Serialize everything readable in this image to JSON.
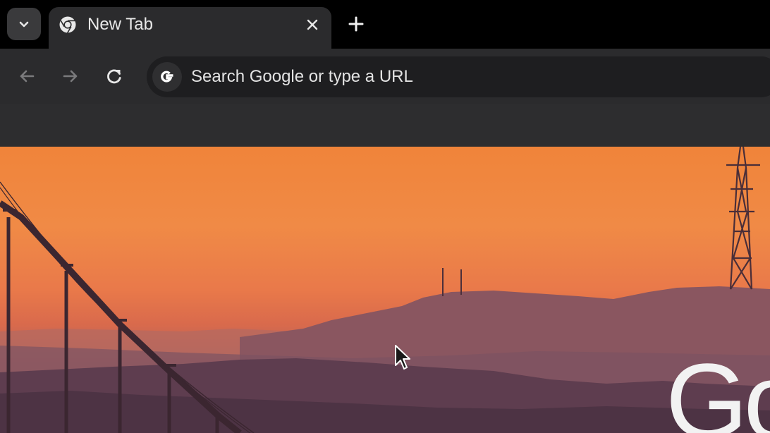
{
  "tabstrip": {
    "tab_search_icon": "chevron-down-icon",
    "active_tab": {
      "title": "New Tab",
      "favicon": "chrome-icon",
      "close_icon": "close-icon"
    },
    "new_tab_icon": "plus-icon"
  },
  "toolbar": {
    "back_icon": "arrow-left-icon",
    "forward_icon": "arrow-right-icon",
    "reload_icon": "reload-icon",
    "omnibox": {
      "icon": "google-g-icon",
      "placeholder": "Search Google or type a URL"
    }
  },
  "ntp": {
    "background": "Sunset over San Francisco hills with Golden Gate Bridge and Sutro Tower",
    "logo_fragment": "Go"
  },
  "colors": {
    "tabstrip_bg": "#000000",
    "toolbar_bg": "#2b2b2d",
    "omnibox_bg": "#1e1e20"
  }
}
